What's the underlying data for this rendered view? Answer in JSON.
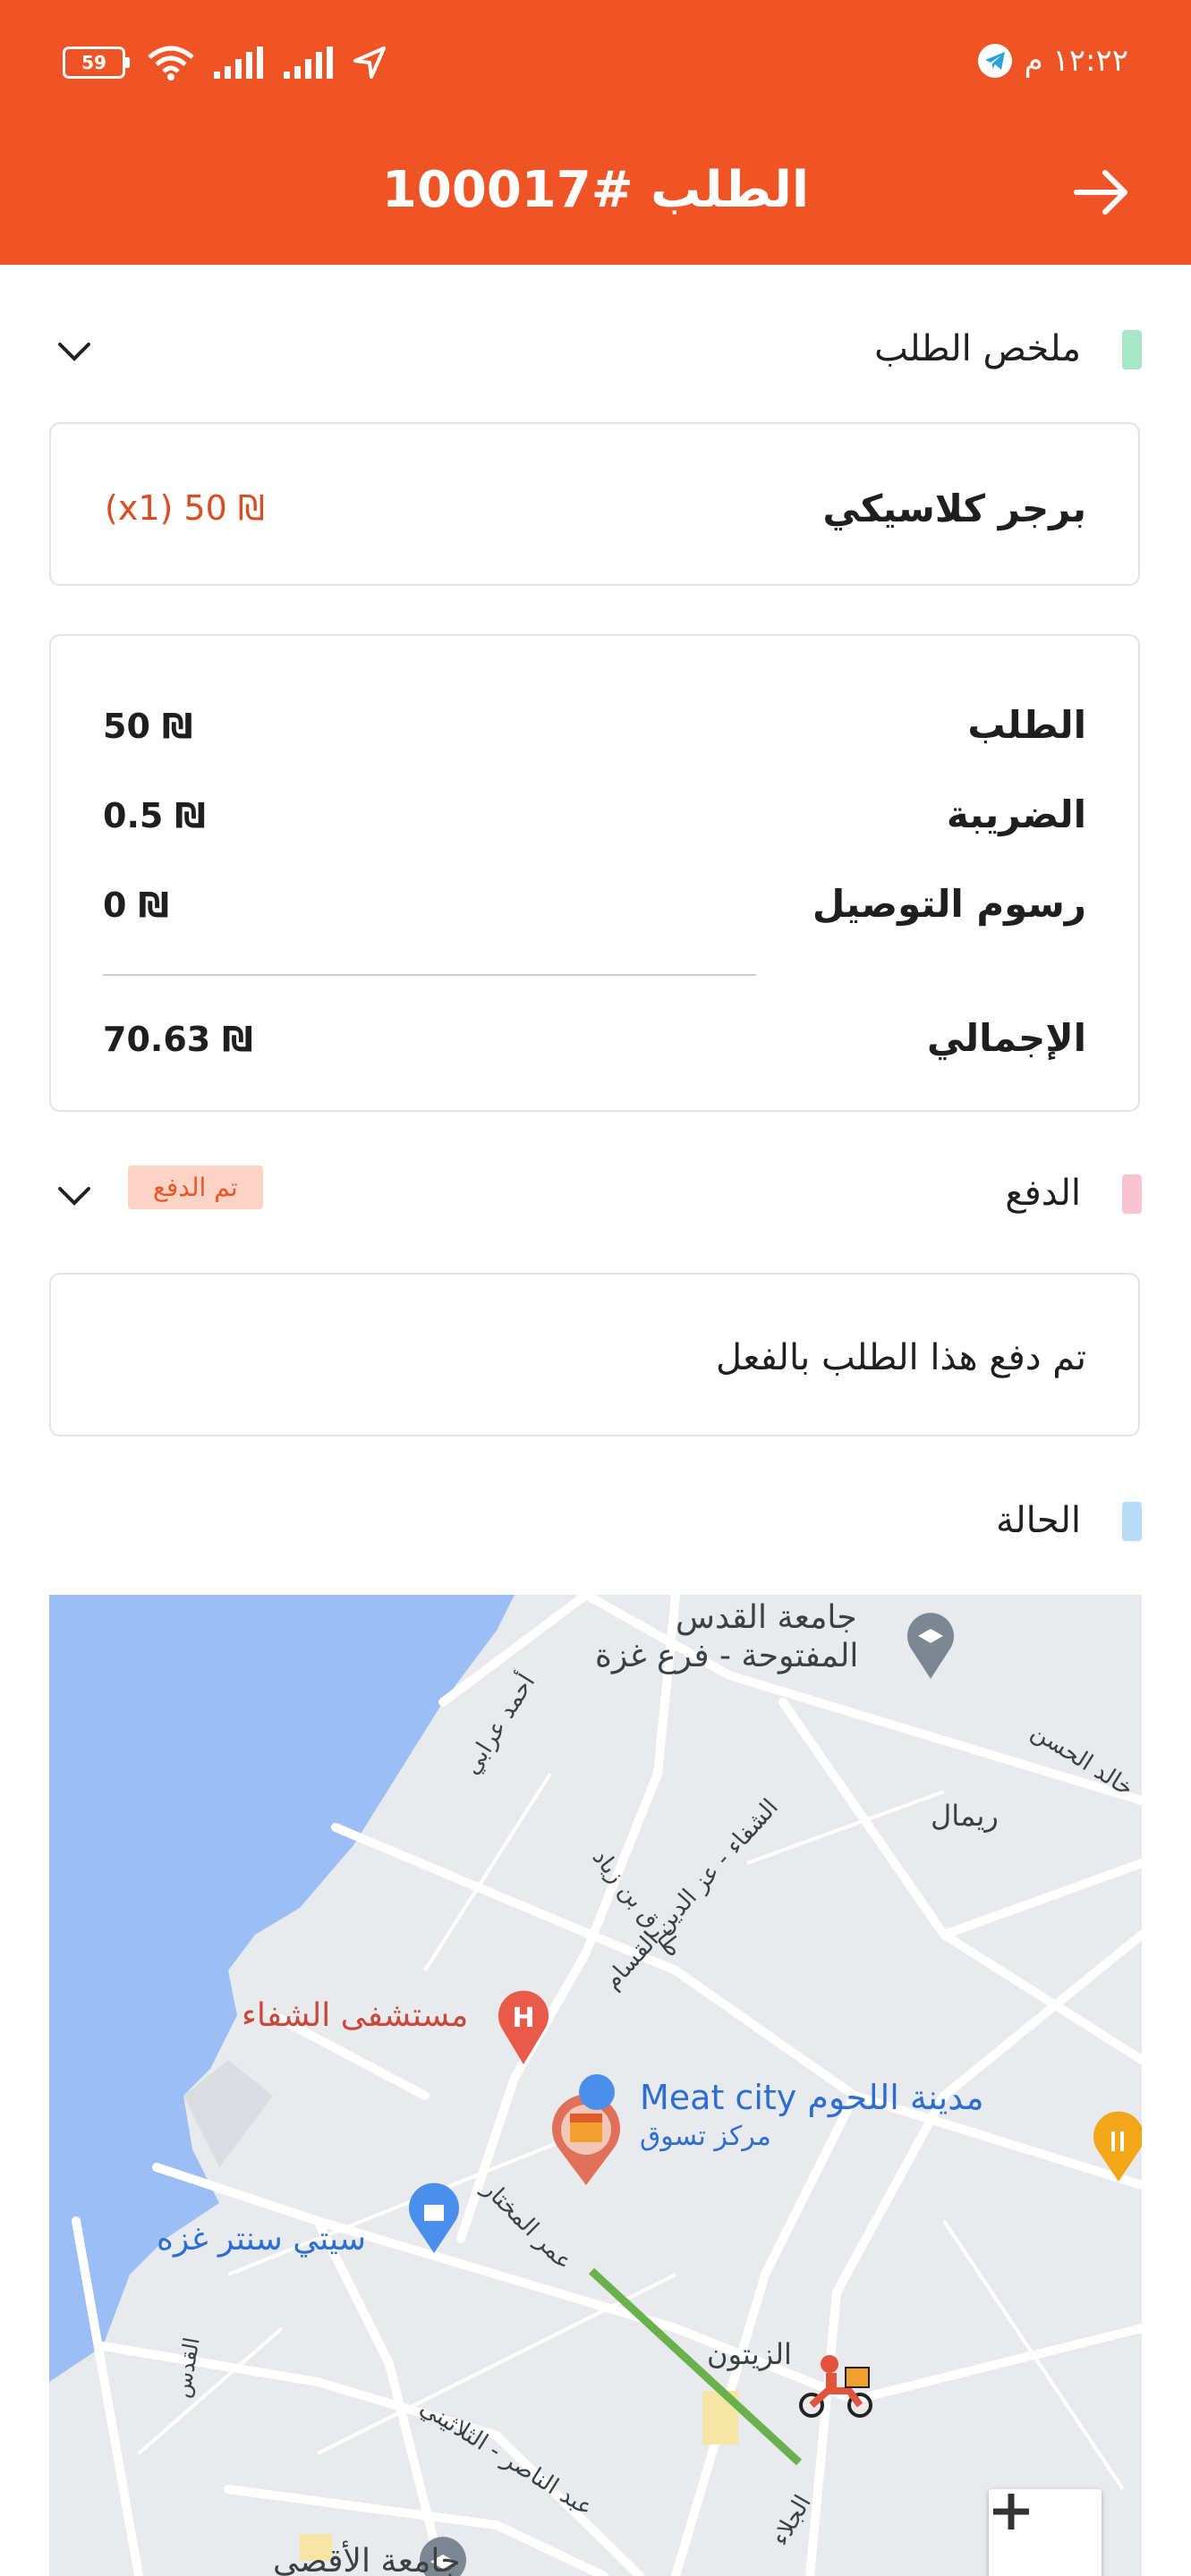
{
  "status_bar": {
    "battery": "59",
    "time": "١٢:٢٢ م"
  },
  "header": {
    "title": "الطلب #100017"
  },
  "summary": {
    "label": "ملخص الطلب",
    "item": {
      "name": "برجر كلاسيكي",
      "price": "(x1) 50 ₪"
    }
  },
  "totals": {
    "order_label": "الطلب",
    "order_value": "50 ₪",
    "tax_label": "الضريبة",
    "tax_value": "0.5 ₪",
    "delivery_label": "رسوم التوصيل",
    "delivery_value": "0 ₪",
    "total_label": "الإجمالي",
    "total_value": "70.63 ₪"
  },
  "payment": {
    "label": "الدفع",
    "badge": "تم الدفع",
    "message": "تم دفع هذا الطلب بالفعل"
  },
  "status": {
    "label": "الحالة"
  },
  "map": {
    "labels": {
      "university_1": "جامعة القدس",
      "university_2": "المفتوحة - فرع غزة",
      "rimal": "ريمال",
      "khalid": "خالد الحسن",
      "ahmed": "أحمد عرابي",
      "shifa_street": "الشفاء - عز الدين القسام",
      "tariq": "طارق بن زياد",
      "hospital": "مستشفى الشفاء",
      "meat_city": "مدينة اللحوم Meat city",
      "shopping": "مركز تسوق",
      "city_center": "سيتي سنتر غزه",
      "omar": "عمر المختار",
      "quds": "القدس",
      "zeitoun": "الزيتون",
      "nasser": "عبد الناصر - الثلاثيني",
      "jalaa": "الجلاء",
      "aqsa": "جامعة الأقصى"
    },
    "zoom_in": "+"
  },
  "colors": {
    "primary": "#ef5426",
    "summary_bar": "#a8e6c8",
    "payment_bar": "#f9c4d2",
    "status_bar": "#b9dcf7",
    "route": "#6ab04c"
  }
}
